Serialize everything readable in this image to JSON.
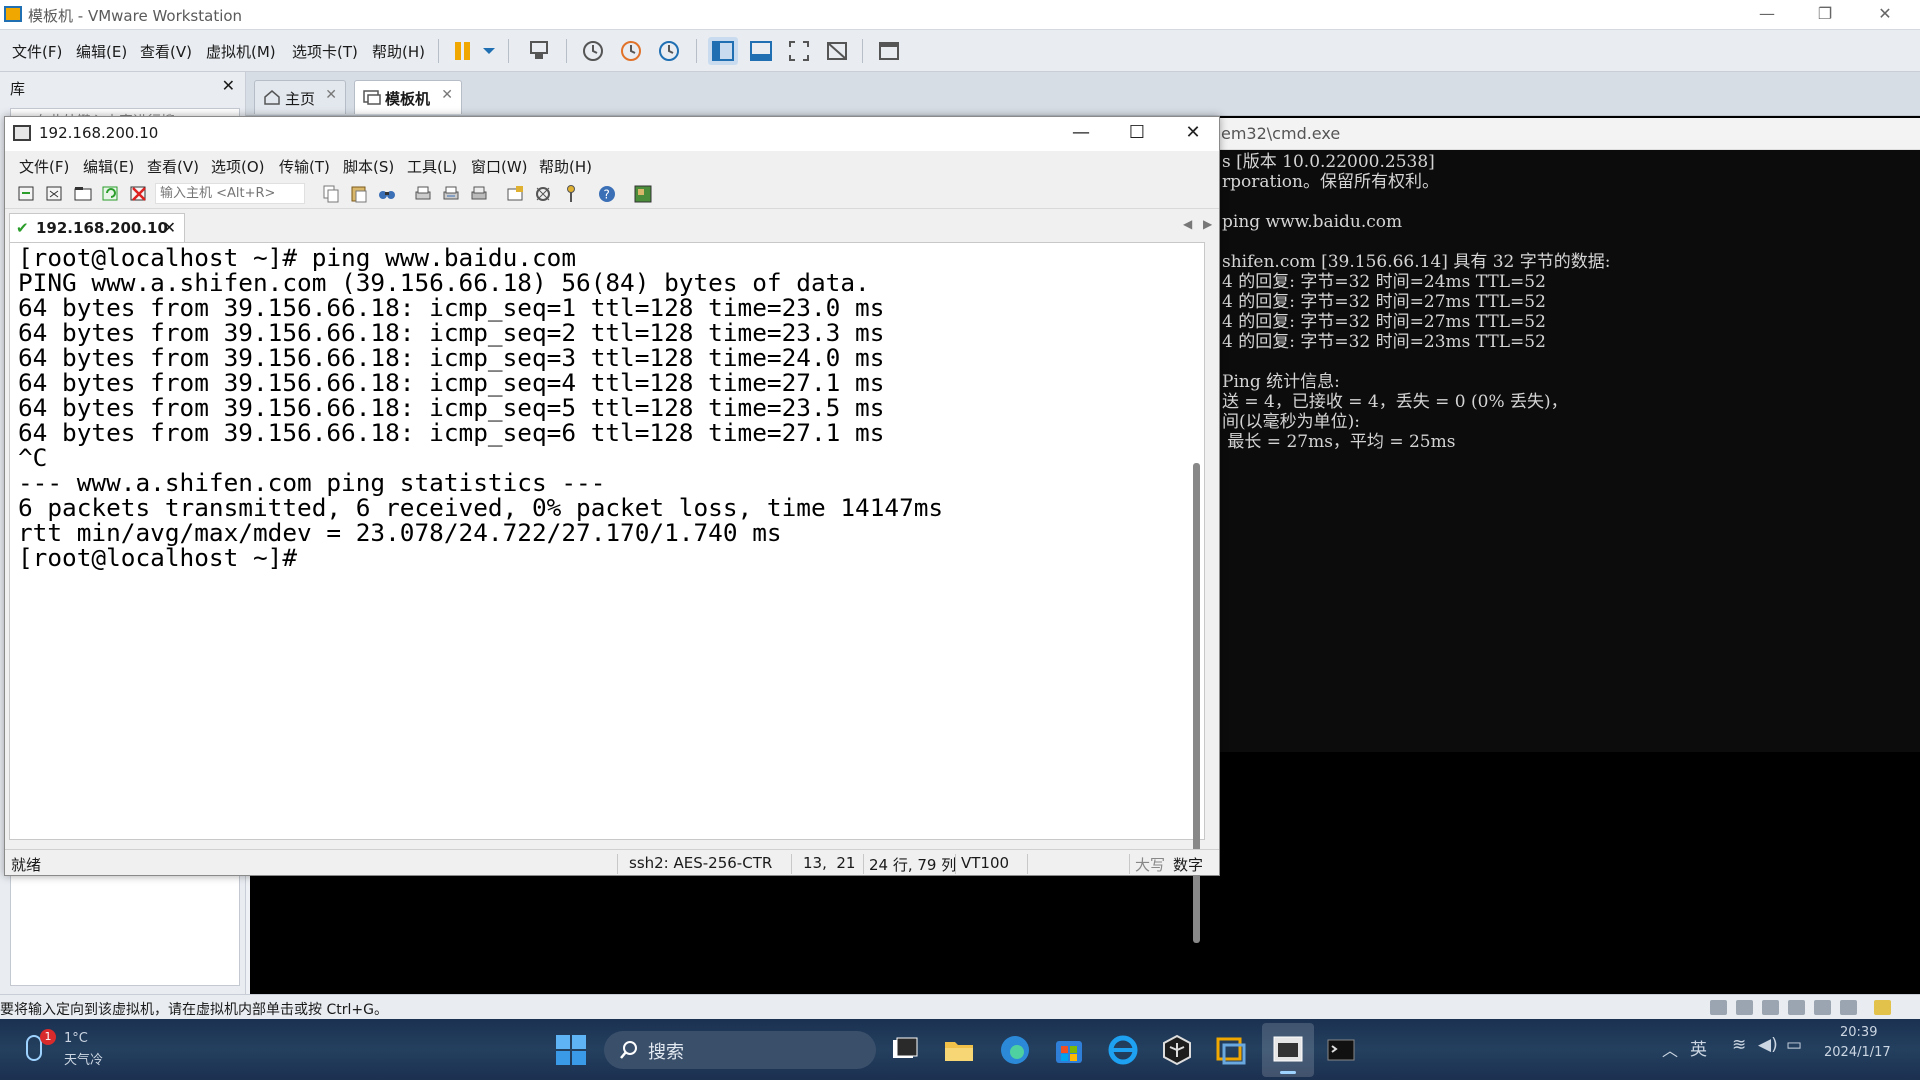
{
  "vmware": {
    "title": "模板机 - VMware Workstation",
    "menu": [
      "文件(F)",
      "编辑(E)",
      "查看(V)",
      "虚拟机(M)",
      "选项卡(T)",
      "帮助(H)"
    ],
    "library": {
      "header": "库",
      "item": "在此处键入内容进行搜"
    },
    "tabs": [
      {
        "label": "主页"
      },
      {
        "label": "模板机"
      }
    ],
    "status_text": "要将输入定向到该虚拟机，请在虚拟机内部单击或按 Ctrl+G。"
  },
  "cmd": {
    "title": "em32\\cmd.exe",
    "lines": [
      "s [版本 10.0.22000.2538]",
      "rporation。保留所有权利。",
      "",
      "ping www.baidu.com",
      "",
      "shifen.com [39.156.66.14] 具有 32 字节的数据:",
      "4 的回复: 字节=32 时间=24ms TTL=52",
      "4 的回复: 字节=32 时间=27ms TTL=52",
      "4 的回复: 字节=32 时间=27ms TTL=52",
      "4 的回复: 字节=32 时间=23ms TTL=52",
      "",
      "Ping 统计信息:",
      "送 = 4，已接收 = 4，丢失 = 0 (0% 丢失)，",
      "间(以毫秒为单位):",
      " 最长 = 27ms，平均 = 25ms"
    ]
  },
  "crt": {
    "title": "192.168.200.10",
    "menu": [
      "文件(F)",
      "编辑(E)",
      "查看(V)",
      "选项(O)",
      "传输(T)",
      "脚本(S)",
      "工具(L)",
      "窗口(W)",
      "帮助(H)"
    ],
    "connect_placeholder": "输入主机 <Alt+R>",
    "session_tab": "192.168.200.10",
    "terminal_lines": [
      "[root@localhost ~]# ping www.baidu.com",
      "PING www.a.shifen.com (39.156.66.18) 56(84) bytes of data.",
      "64 bytes from 39.156.66.18: icmp_seq=1 ttl=128 time=23.0 ms",
      "64 bytes from 39.156.66.18: icmp_seq=2 ttl=128 time=23.3 ms",
      "64 bytes from 39.156.66.18: icmp_seq=3 ttl=128 time=24.0 ms",
      "64 bytes from 39.156.66.18: icmp_seq=4 ttl=128 time=27.1 ms",
      "64 bytes from 39.156.66.18: icmp_seq=5 ttl=128 time=23.5 ms",
      "64 bytes from 39.156.66.18: icmp_seq=6 ttl=128 time=27.1 ms",
      "^C",
      "--- www.a.shifen.com ping statistics ---",
      "6 packets transmitted, 6 received, 0% packet loss, time 14147ms",
      "rtt min/avg/max/mdev = 23.078/24.722/27.170/1.740 ms",
      "[root@localhost ~]# "
    ],
    "status": {
      "ready": "就绪",
      "cipher": "ssh2: AES-256-CTR",
      "cursor": "13,  21",
      "size": "24 行, 79 列",
      "emulation": "VT100",
      "caps": "大写",
      "num": "数字"
    }
  },
  "taskbar": {
    "weather_badge": "1",
    "weather_temp": "1°C",
    "weather_cond": "天气冷",
    "search_label": "搜索",
    "ime": "英",
    "time": "20:39",
    "date": "2024/1/17"
  },
  "colors": {
    "vmware_accent": "#1f6fb2",
    "pause_orange": "#f0a800",
    "terminal_bg": "#ffffff",
    "cmd_bg": "#0c0c0c",
    "taskbar_bg": "#1f3555"
  }
}
